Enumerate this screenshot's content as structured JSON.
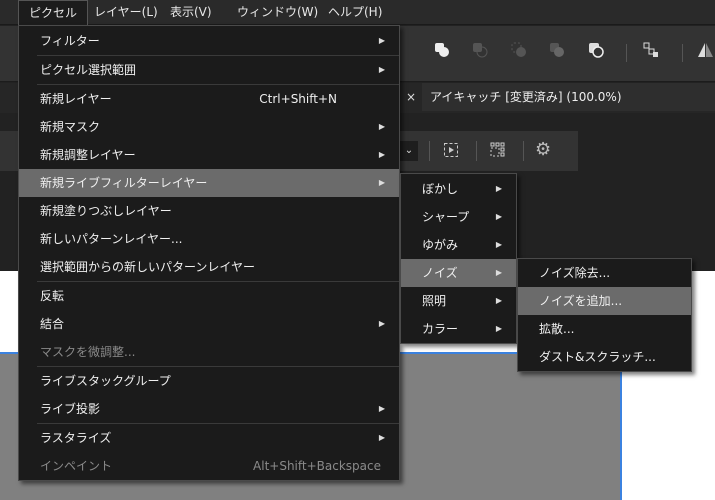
{
  "menubar": {
    "items": [
      "ピクセル",
      "レイヤー(L)",
      "表示(V)",
      "ウィンドウ(W)",
      "ヘルプ(H)"
    ]
  },
  "document_tab": {
    "title": "アイキャッチ [変更済み] (100.0%)",
    "close": "×"
  },
  "pixel_menu": {
    "items": [
      {
        "label": "フィルター",
        "submenu": true
      },
      {
        "label": "ピクセル選択範囲",
        "submenu": true
      },
      {
        "label": "新規レイヤー",
        "shortcut": "Ctrl+Shift+N"
      },
      {
        "label": "新規マスク",
        "submenu": true
      },
      {
        "label": "新規調整レイヤー",
        "submenu": true
      },
      {
        "label": "新規ライブフィルターレイヤー",
        "submenu": true,
        "highlighted": true
      },
      {
        "label": "新規塗りつぶしレイヤー"
      },
      {
        "label": "新しいパターンレイヤー..."
      },
      {
        "label": "選択範囲からの新しいパターンレイヤー"
      },
      {
        "label": "反転"
      },
      {
        "label": "結合",
        "submenu": true
      },
      {
        "label": "マスクを微調整...",
        "disabled": true
      },
      {
        "label": "ライブスタックグループ"
      },
      {
        "label": "ライブ投影",
        "submenu": true
      },
      {
        "label": "ラスタライズ",
        "submenu": true
      },
      {
        "label": "インペイント",
        "shortcut": "Alt+Shift+Backspace",
        "disabled": true
      }
    ]
  },
  "live_filter_menu": {
    "items": [
      "ぼかし",
      "シャープ",
      "ゆがみ",
      "ノイズ",
      "照明",
      "カラー"
    ]
  },
  "noise_menu": {
    "items": [
      "ノイズ除去...",
      "ノイズを追加...",
      "拡散...",
      "ダスト&スクラッチ..."
    ]
  },
  "arrow": "▶"
}
